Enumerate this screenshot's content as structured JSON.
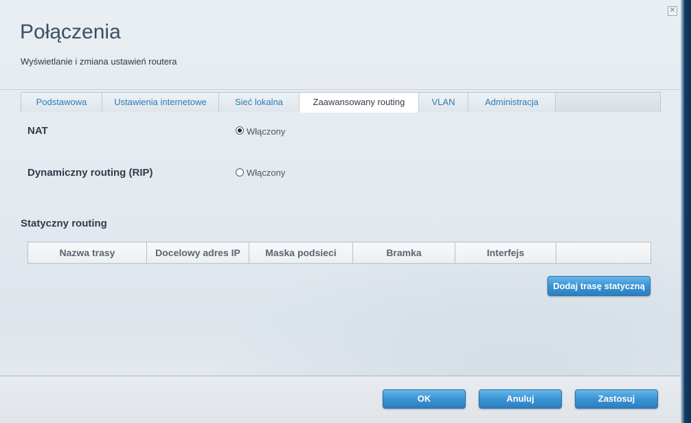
{
  "dialog": {
    "title": "Połączenia",
    "subtitle": "Wyświetlanie i zmiana ustawień routera",
    "close_glyph": "✕"
  },
  "tabs": [
    {
      "label": "Podstawowa",
      "active": false
    },
    {
      "label": "Ustawienia internetowe",
      "active": false
    },
    {
      "label": "Sieć lokalna",
      "active": false
    },
    {
      "label": "Zaawansowany routing",
      "active": true
    },
    {
      "label": "VLAN",
      "active": false
    },
    {
      "label": "Administracja",
      "active": false
    }
  ],
  "nat": {
    "label": "NAT",
    "option_label": "Włączony",
    "checked": true
  },
  "rip": {
    "label": "Dynamiczny routing (RIP)",
    "option_label": "Włączony",
    "checked": false
  },
  "static_routing": {
    "title": "Statyczny routing",
    "columns": [
      "Nazwa trasy",
      "Docelowy adres IP",
      "Maska podsieci",
      "Bramka",
      "Interfejs",
      ""
    ],
    "add_button": "Dodaj trasę statyczną"
  },
  "footer": {
    "ok": "OK",
    "cancel": "Anuluj",
    "apply": "Zastosuj"
  },
  "colors": {
    "accent_blue": "#3b93d3",
    "tab_text": "#2d7ab4",
    "title_text": "#3a4f63"
  }
}
